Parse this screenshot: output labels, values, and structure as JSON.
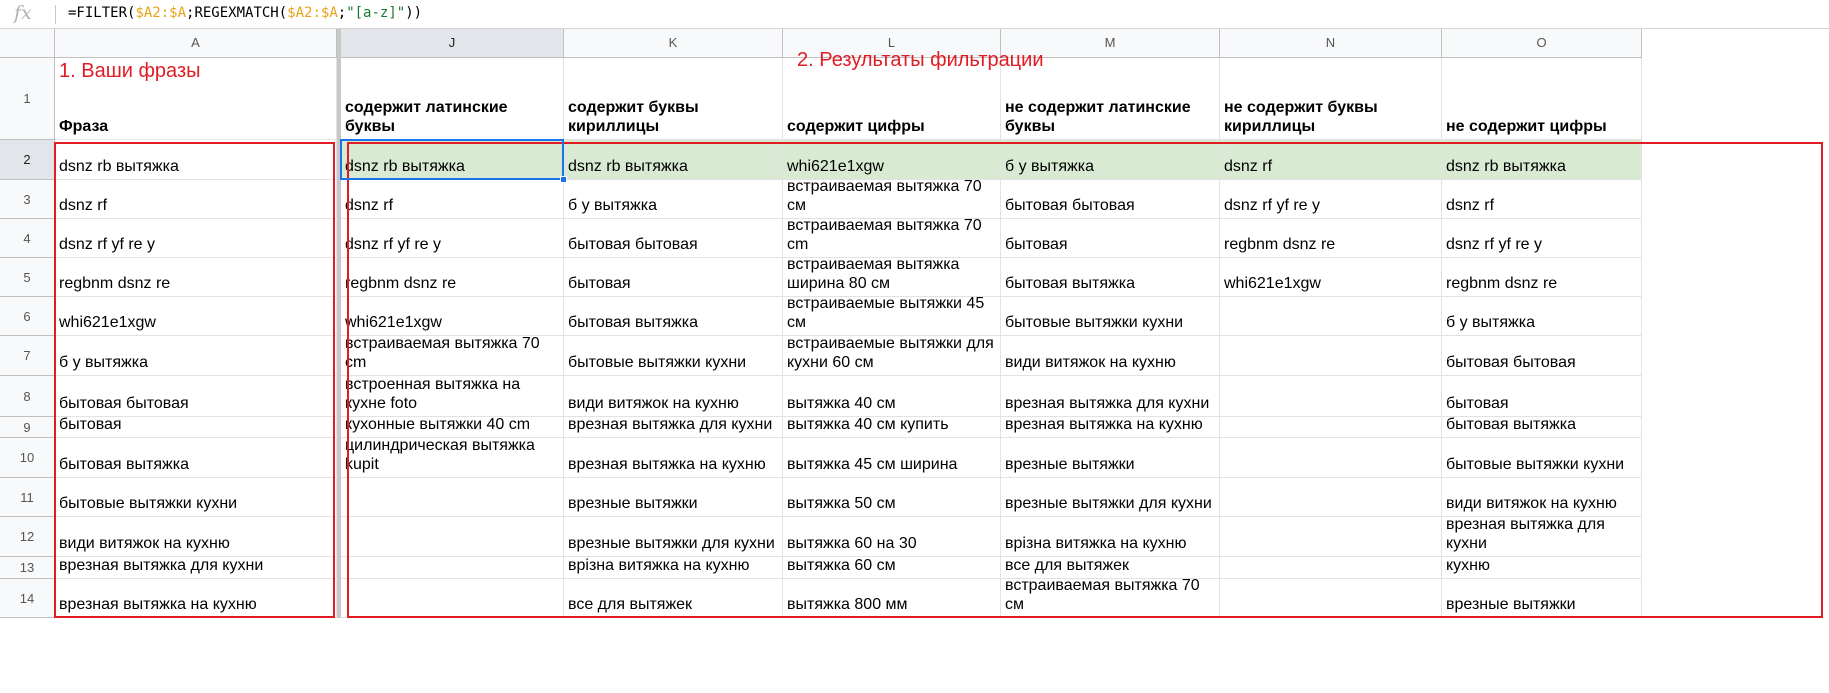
{
  "formula_bar": {
    "fx_icon": "fx-icon",
    "formula_parts": [
      {
        "t": "=FILTER(",
        "c": ""
      },
      {
        "t": "$A2:$A",
        "c": "ref"
      },
      {
        "t": ";REGEXMATCH(",
        "c": ""
      },
      {
        "t": "$A2:$A",
        "c": "ref"
      },
      {
        "t": ";",
        "c": ""
      },
      {
        "t": "\"[a-z]\"",
        "c": "str"
      },
      {
        "t": "))",
        "c": ""
      }
    ]
  },
  "annotations": {
    "left": "1. Ваши фразы",
    "right": "2. Результаты фильтрации"
  },
  "columns": [
    "A",
    "J",
    "K",
    "L",
    "M",
    "N",
    "O"
  ],
  "row_numbers": [
    "1",
    "2",
    "3",
    "4",
    "5",
    "6",
    "7",
    "8",
    "9",
    "10",
    "11",
    "12",
    "13",
    "14"
  ],
  "headers": {
    "A": "Фраза",
    "J": "содержит латинские буквы",
    "K": "содержит буквы кириллицы",
    "L": "содержит цифры",
    "M": "не содержит латинские буквы",
    "N": "не содержит буквы кириллицы",
    "O": "не содержит цифры"
  },
  "rows": [
    {
      "A": "dsnz rb вытяжка",
      "J": "dsnz rb вытяжка",
      "K": "dsnz rb вытяжка",
      "L": "whi621e1xgw",
      "M": "б у вытяжка",
      "N": "dsnz rf",
      "O": "dsnz rb вытяжка"
    },
    {
      "A": "dsnz rf",
      "J": "dsnz rf",
      "K": "б у вытяжка",
      "L": "встраиваемая вытяжка 70 см",
      "M": "бытовая бытовая",
      "N": "dsnz rf yf re y",
      "O": "dsnz rf"
    },
    {
      "A": "dsnz rf yf re y",
      "J": "dsnz rf yf re y",
      "K": "бытовая бытовая",
      "L": "встраиваемая вытяжка 70 cm",
      "M": "бытовая",
      "N": "regbnm dsnz re",
      "O": "dsnz rf yf re y"
    },
    {
      "A": "regbnm dsnz re",
      "J": "regbnm dsnz re",
      "K": "бытовая",
      "L": "встраиваемая вытяжка ширина 80 см",
      "M": "бытовая вытяжка",
      "N": "whi621e1xgw",
      "O": "regbnm dsnz re"
    },
    {
      "A": "whi621e1xgw",
      "J": "whi621e1xgw",
      "K": "бытовая вытяжка",
      "L": "встраиваемые вытяжки 45 см",
      "M": "бытовые вытяжки кухни",
      "N": "",
      "O": "б у вытяжка"
    },
    {
      "A": "б у вытяжка",
      "J": "встраиваемая вытяжка 70 cm",
      "K": "бытовые вытяжки кухни",
      "L": "встраиваемые вытяжки для кухни 60 см",
      "M": "види витяжок на кухню",
      "N": "",
      "O": "бытовая бытовая"
    },
    {
      "A": "бытовая бытовая",
      "J": "встроенная вытяжка на кухне foto",
      "K": "види витяжок на кухню",
      "L": "вытяжка 40 см",
      "M": "врезная вытяжка для кухни",
      "N": "",
      "O": "бытовая"
    },
    {
      "A": "бытовая",
      "J": "кухонные вытяжки 40 cm",
      "K": "врезная вытяжка для кухни",
      "L": "вытяжка 40 см купить",
      "M": "врезная вытяжка на кухню",
      "N": "",
      "O": "бытовая вытяжка"
    },
    {
      "A": "бытовая вытяжка",
      "J": "цилиндрическая вытяжка kupit",
      "K": "врезная вытяжка на кухню",
      "L": "вытяжка 45 см ширина",
      "M": "врезные вытяжки",
      "N": "",
      "O": "бытовые вытяжки кухни"
    },
    {
      "A": "бытовые вытяжки кухни",
      "J": "",
      "K": "врезные вытяжки",
      "L": "вытяжка 50 см",
      "M": "врезные вытяжки для кухни",
      "N": "",
      "O": "види витяжок на кухню"
    },
    {
      "A": "види витяжок на кухню",
      "J": "",
      "K": "врезные вытяжки для кухни",
      "L": "вытяжка 60 на 30",
      "M": "врізна витяжка на кухню",
      "N": "",
      "O": "врезная вытяжка для кухни"
    },
    {
      "A": "врезная вытяжка для кухни",
      "J": "",
      "K": "врізна витяжка на кухню",
      "L": "вытяжка 60 см",
      "M": "все для вытяжек",
      "N": "",
      "O": "врезная вытяжка на кухню"
    },
    {
      "A": "врезная вытяжка на кухню",
      "J": "",
      "K": "все для вытяжек",
      "L": "вытяжка 800 мм",
      "M": "встраиваемая вытяжка 70 см",
      "N": "",
      "O": "врезные вытяжки"
    }
  ],
  "colors": {
    "annotation_red": "#e01b24",
    "selection_blue": "#1a73e8",
    "highlight_green": "#d9ead3",
    "ref_orange": "#e8a317",
    "string_green": "#1b7a2c"
  }
}
